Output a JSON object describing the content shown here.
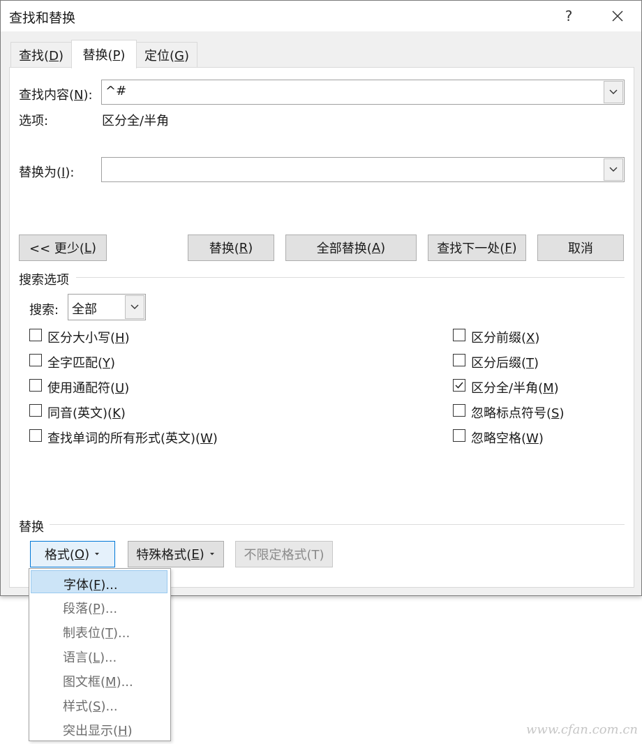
{
  "window": {
    "title": "查找和替换",
    "help": "?",
    "close": "✕"
  },
  "tabs": [
    {
      "label": "查找(",
      "key": "D",
      "tail": ")"
    },
    {
      "label": "替换(",
      "key": "P",
      "tail": ")"
    },
    {
      "label": "定位(",
      "key": "G",
      "tail": ")"
    }
  ],
  "find": {
    "label": "查找内容(",
    "key": "N",
    "tail": "):",
    "value": "^#"
  },
  "options": {
    "label": "选项:",
    "value": "区分全/半角"
  },
  "replace": {
    "label": "替换为(",
    "key": "I",
    "tail": "):",
    "value": ""
  },
  "buttons": {
    "less": {
      "pre": "<< 更少(",
      "key": "L",
      "tail": ")"
    },
    "replace": {
      "pre": "替换(",
      "key": "R",
      "tail": ")"
    },
    "replace_all": {
      "pre": "全部替换(",
      "key": "A",
      "tail": ")"
    },
    "find_next": {
      "pre": "查找下一处(",
      "key": "F",
      "tail": ")"
    },
    "cancel": "取消"
  },
  "search_options": {
    "heading": "搜索选项",
    "search_label": "搜索:",
    "search_value": "全部",
    "left": [
      {
        "pre": "区分大小写(",
        "key": "H",
        "tail": ")",
        "checked": false
      },
      {
        "pre": "全字匹配(",
        "key": "Y",
        "tail": ")",
        "checked": false
      },
      {
        "pre": "使用通配符(",
        "key": "U",
        "tail": ")",
        "checked": false
      },
      {
        "pre": "同音(英文)(",
        "key": "K",
        "tail": ")",
        "checked": false
      },
      {
        "pre": "查找单词的所有形式(英文)(",
        "key": "W",
        "tail": ")",
        "checked": false
      }
    ],
    "right": [
      {
        "pre": "区分前缀(",
        "key": "X",
        "tail": ")",
        "checked": false
      },
      {
        "pre": "区分后缀(",
        "key": "T",
        "tail": ")",
        "checked": false
      },
      {
        "pre": "区分全/半角(",
        "key": "M",
        "tail": ")",
        "checked": true
      },
      {
        "pre": "忽略标点符号(",
        "key": "S",
        "tail": ")",
        "checked": false
      },
      {
        "pre": "忽略空格(",
        "key": "W",
        "tail": ")",
        "checked": false
      }
    ]
  },
  "replace_section": {
    "heading": "替换",
    "format": {
      "pre": "格式(",
      "key": "O",
      "tail": ")"
    },
    "special": {
      "pre": "特殊格式(",
      "key": "E",
      "tail": ")"
    },
    "no_format": "不限定格式(T)"
  },
  "format_menu": [
    {
      "pre": "字体(",
      "key": "F",
      "tail": ")..."
    },
    {
      "pre": "段落(",
      "key": "P",
      "tail": ")..."
    },
    {
      "pre": "制表位(",
      "key": "T",
      "tail": ")..."
    },
    {
      "pre": "语言(",
      "key": "L",
      "tail": ")..."
    },
    {
      "pre": "图文框(",
      "key": "M",
      "tail": ")..."
    },
    {
      "pre": "样式(",
      "key": "S",
      "tail": ")..."
    },
    {
      "pre": "突出显示(",
      "key": "H",
      "tail": ")"
    }
  ],
  "watermark": "www.cfan.com.cn",
  "colors": {
    "focus": "#0078d7",
    "highlight": "#cce4f7"
  }
}
